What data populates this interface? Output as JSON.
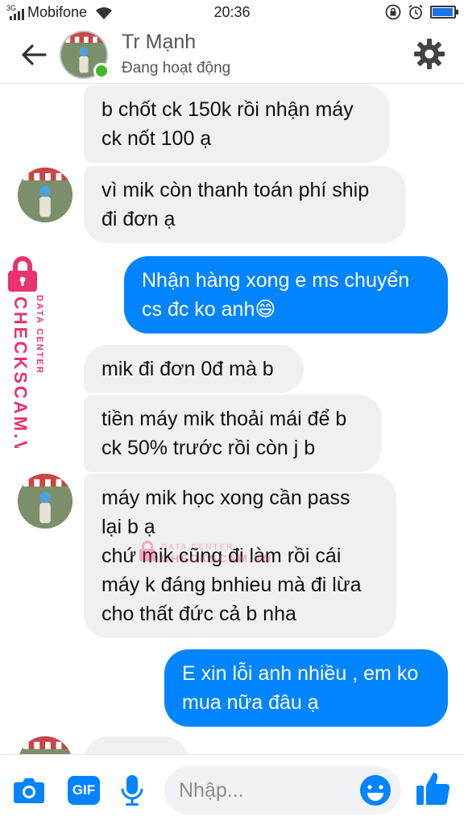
{
  "status_bar": {
    "network": "3G",
    "carrier": "Mobifone",
    "time": "20:36",
    "battery_level": 0.95,
    "icons": [
      "signal-icon",
      "wifi-icon",
      "screen-lock-icon",
      "alarm-icon",
      "battery-icon"
    ]
  },
  "header": {
    "contact_name": "Tr Mạnh",
    "contact_status": "Đang hoạt động",
    "back_icon": "arrow-left-icon",
    "settings_icon": "gear-icon",
    "online_color": "#42b72a"
  },
  "messages": [
    {
      "direction": "in",
      "text": "b chốt ck 150k rồi nhận máy\nck nốt 100 ạ"
    },
    {
      "direction": "in",
      "text": "vì mik còn thanh toán phí ship\nđi đơn ạ"
    },
    {
      "direction": "out",
      "text": "Nhận hàng xong e ms chuyển\ncs đc ko anh😄"
    },
    {
      "direction": "in",
      "text": "mik đi đơn 0đ mà b"
    },
    {
      "direction": "in",
      "text": "tiền máy mik thoải mái để b\nck 50% trước rồi còn j b"
    },
    {
      "direction": "in",
      "text": "máy mik học xong cần pass\nlại b ạ\nchứ mik cũng đi làm rồi cái\nmáy k đáng bnhieu mà đi lừa\ncho thất đức cả b nha"
    },
    {
      "direction": "out",
      "text": "E xin lỗi anh nhiều , em ko\nmua nữa đâu ạ"
    },
    {
      "direction": "in",
      "text": ""
    }
  ],
  "watermark": {
    "side_line1": "CHECKSCAM.VN",
    "side_line2": "DATA CENTER",
    "center_line1": "DATA CENTER",
    "center_line2": "CHECKSCAM.VN",
    "color": "#e8336d"
  },
  "composer": {
    "placeholder": "Nhập...",
    "value": "",
    "camera_icon": "camera-icon",
    "gif_label": "GIF",
    "mic_icon": "microphone-icon",
    "emoji_icon": "smiley-icon",
    "like_icon": "thumbs-up-icon"
  },
  "colors": {
    "accent": "#0084ff",
    "incoming_bubble": "#f1f0f0"
  }
}
